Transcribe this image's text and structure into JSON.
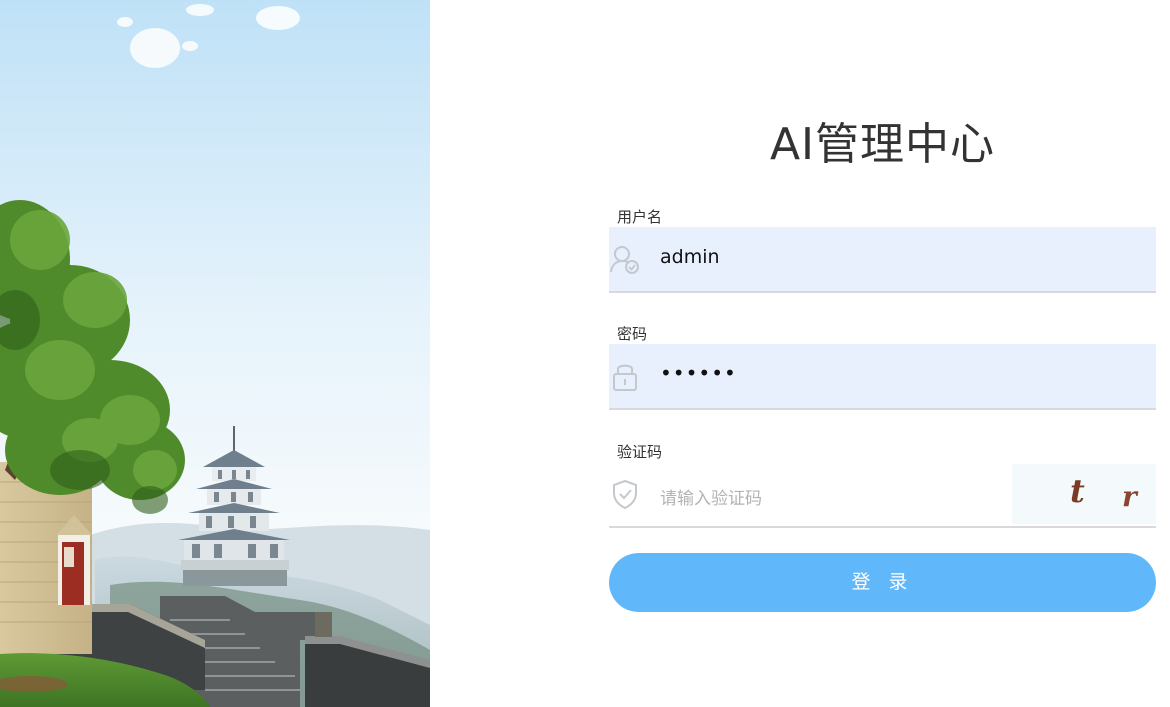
{
  "app": {
    "title": "AI管理中心"
  },
  "form": {
    "username": {
      "label": "用户名",
      "value": "admin",
      "icon": "user-shield-icon"
    },
    "password": {
      "label": "密码",
      "value": "••••••",
      "icon": "lock-icon"
    },
    "captcha": {
      "label": "验证码",
      "placeholder": "请输入验证码",
      "icon": "shield-check-icon",
      "image_chars": [
        "t",
        "r"
      ]
    },
    "submit_label": "登 录"
  },
  "colors": {
    "accent": "#60b8fb",
    "input_fill": "#e8f0fe",
    "text": "#333333"
  }
}
